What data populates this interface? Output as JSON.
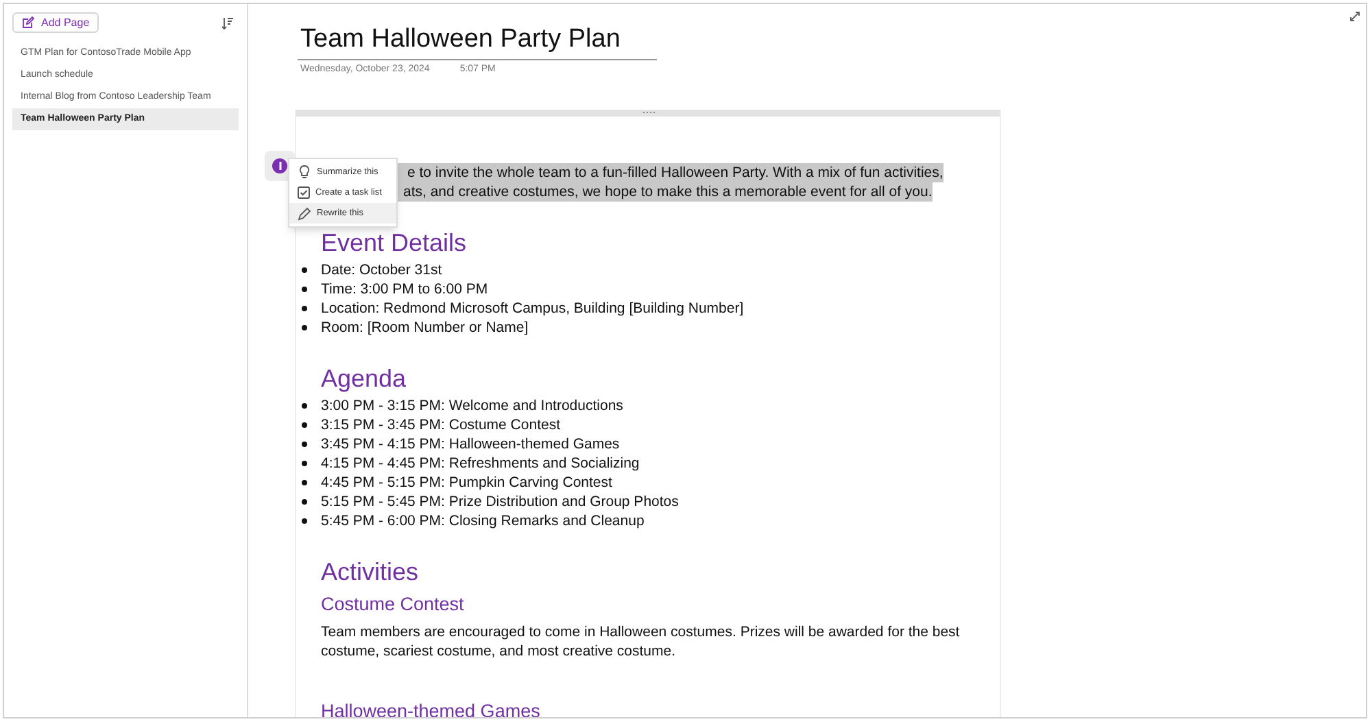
{
  "sidebar": {
    "add_page": "Add Page",
    "pages": [
      {
        "title": "GTM Plan for ContosoTrade Mobile App",
        "selected": false
      },
      {
        "title": "Launch schedule",
        "selected": false
      },
      {
        "title": "Internal Blog from Contoso Leadership Team",
        "selected": false
      },
      {
        "title": "Team Halloween Party Plan",
        "selected": true
      }
    ]
  },
  "page": {
    "title": "Team Halloween Party Plan",
    "date": "Wednesday, October 23, 2024",
    "time": "5:07 PM",
    "intro_lines": [
      "e to invite the whole team to a fun-filled Halloween Party. With a mix of fun activities,",
      "ats, and creative costumes, we hope to make this a memorable event for all of you."
    ],
    "sections": [
      {
        "kind": "heading",
        "text": "Event Details"
      },
      {
        "kind": "list",
        "items": [
          "Date: October 31st",
          "Time: 3:00 PM to 6:00 PM",
          "Location: Redmond Microsoft Campus, Building [Building Number]",
          "Room: [Room Number or Name]"
        ]
      },
      {
        "kind": "heading",
        "text": "Agenda"
      },
      {
        "kind": "list",
        "items": [
          "3:00 PM - 3:15 PM: Welcome and Introductions",
          "3:15 PM - 3:45 PM: Costume Contest",
          "3:45 PM - 4:15 PM: Halloween-themed Games",
          "4:15 PM - 4:45 PM: Refreshments and Socializing",
          "4:45 PM - 5:15 PM: Pumpkin Carving Contest",
          "5:15 PM - 5:45 PM: Prize Distribution and Group Photos",
          "5:45 PM - 6:00 PM: Closing Remarks and Cleanup"
        ]
      },
      {
        "kind": "heading",
        "text": "Activities"
      },
      {
        "kind": "subheading",
        "text": "Costume Contest"
      },
      {
        "kind": "paragraph",
        "text": "Team members are encouraged to come in Halloween costumes. Prizes will be awarded for the best costume, scariest costume, and most creative costume."
      },
      {
        "kind": "subheading",
        "text": "Halloween-themed Games"
      }
    ]
  },
  "copilot_menu": {
    "items": [
      {
        "label": "Summarize this",
        "selected": false
      },
      {
        "label": "Create a task list",
        "selected": false
      },
      {
        "label": "Rewrite this",
        "selected": true
      }
    ]
  }
}
